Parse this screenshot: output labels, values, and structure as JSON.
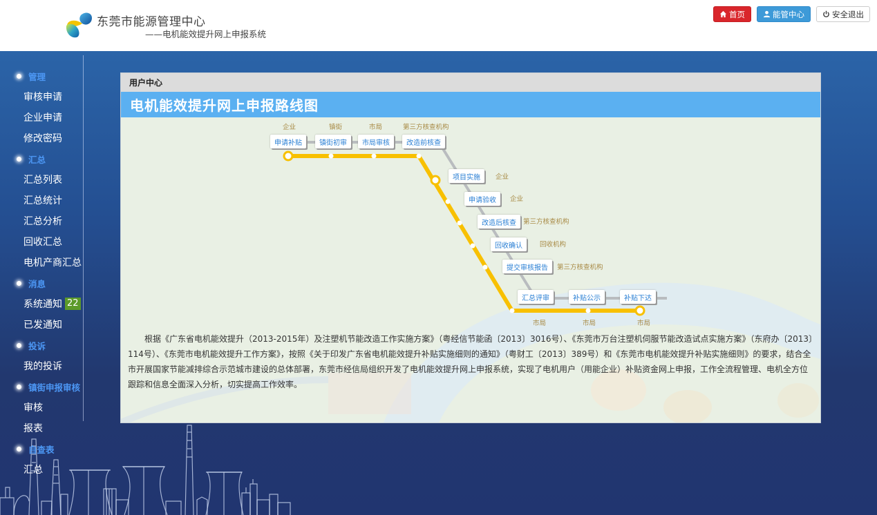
{
  "header": {
    "org_name": "东莞市能源管理中心",
    "system_name": "——电机能效提升网上申报系统",
    "buttons": {
      "home": "首页",
      "energy_center": "能管中心",
      "logout": "安全退出"
    }
  },
  "sidebar": {
    "groups": [
      {
        "label": "管理",
        "items": [
          "审核申请",
          "企业申请",
          "修改密码"
        ]
      },
      {
        "label": "汇总",
        "items": [
          "汇总列表",
          "汇总统计",
          "汇总分析",
          "回收汇总",
          "电机产商汇总"
        ]
      },
      {
        "label": "消息",
        "items": [
          "系统通知",
          "已发通知"
        ]
      },
      {
        "label": "投诉",
        "items": [
          "我的投诉"
        ]
      },
      {
        "label": "镇街申报审核",
        "items": [
          "审核",
          "报表"
        ]
      },
      {
        "label": "自查表",
        "items": [
          "汇总"
        ]
      }
    ],
    "notification_badge": "22"
  },
  "panel": {
    "header": "用户中心",
    "title": "电机能效提升网上申报路线图",
    "roadmap": {
      "steps": [
        {
          "label": "申请补贴",
          "role": "企业"
        },
        {
          "label": "镇街初审",
          "role": "镇街"
        },
        {
          "label": "市局审核",
          "role": "市局"
        },
        {
          "label": "改造前核查",
          "role": "第三方核查机构"
        },
        {
          "label": "项目实施",
          "role": "企业"
        },
        {
          "label": "申请验收",
          "role": "企业"
        },
        {
          "label": "改造后核查",
          "role": "第三方核查机构"
        },
        {
          "label": "回收确认",
          "role": "回收机构"
        },
        {
          "label": "提交审核报告",
          "role": "第三方核查机构"
        },
        {
          "label": "汇总评审",
          "role": "市局"
        },
        {
          "label": "补贴公示",
          "role": "市局"
        },
        {
          "label": "补贴下达",
          "role": "市局"
        }
      ]
    },
    "description": "根据《广东省电机能效提升（2013-2015年）及注塑机节能改造工作实施方案》（粤经信节能函〔2013〕3016号）、《东莞市万台注塑机伺服节能改造试点实施方案》（东府办〔2013〕114号）、《东莞市电机能效提升工作方案》，按照《关于印发广东省电机能效提升补贴实施细则的通知》（粤财工〔2013〕389号）和《东莞市电机能效提升补贴实施细则》的要求，结合全市开展国家节能减排综合示范城市建设的总体部署，东莞市经信局组织开发了电机能效提升网上申报系统，实现了电机用户（用能企业）补贴资金网上申报，工作全流程管理、电机全方位跟踪和信息全面深入分析，切实提高工作效率。"
  },
  "colors": {
    "home_button": "#d9262b",
    "center_button": "#3d9ad8",
    "title_bar": "#5bb0f1",
    "route_line": "#f8c000",
    "sidebar_group": "#4c97f4",
    "badge": "#5c9a29",
    "background": "#22386f"
  }
}
